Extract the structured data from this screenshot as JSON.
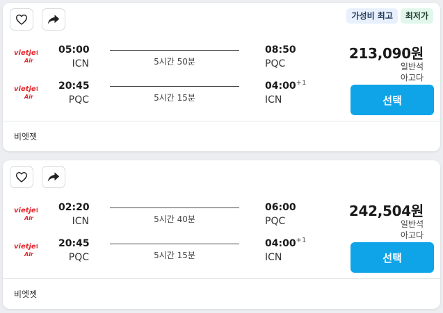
{
  "colors": {
    "accent": "#0fa4e8",
    "page_bg": "#eceef2",
    "badge_blue_bg": "#e7f0fc",
    "badge_green_bg": "#e1f7eb",
    "logo_red": "#e4262c"
  },
  "icons": {
    "favorite": "heart-outline-icon",
    "share": "share-arrow-icon",
    "airline": "vietjet-air-logo-icon"
  },
  "results": [
    {
      "badges": [
        "가성비 최고",
        "최저가"
      ],
      "outbound": {
        "dep_time": "05:00",
        "dep_code": "ICN",
        "duration": "5시간 50분",
        "arr_time": "08:50",
        "arr_day": "",
        "arr_code": "PQC"
      },
      "inbound": {
        "dep_time": "20:45",
        "dep_code": "PQC",
        "duration": "5시간 15분",
        "arr_time": "04:00",
        "arr_day": "+1",
        "arr_code": "ICN"
      },
      "price": "213,090원",
      "cabin": "일반석",
      "provider": "아고다",
      "select_label": "선택",
      "airline": "비엣젯"
    },
    {
      "badges": [],
      "outbound": {
        "dep_time": "02:20",
        "dep_code": "ICN",
        "duration": "5시간 40분",
        "arr_time": "06:00",
        "arr_day": "",
        "arr_code": "PQC"
      },
      "inbound": {
        "dep_time": "20:45",
        "dep_code": "PQC",
        "duration": "5시간 15분",
        "arr_time": "04:00",
        "arr_day": "+1",
        "arr_code": "ICN"
      },
      "price": "242,504원",
      "cabin": "일반석",
      "provider": "아고다",
      "select_label": "선택",
      "airline": "비엣젯"
    }
  ]
}
